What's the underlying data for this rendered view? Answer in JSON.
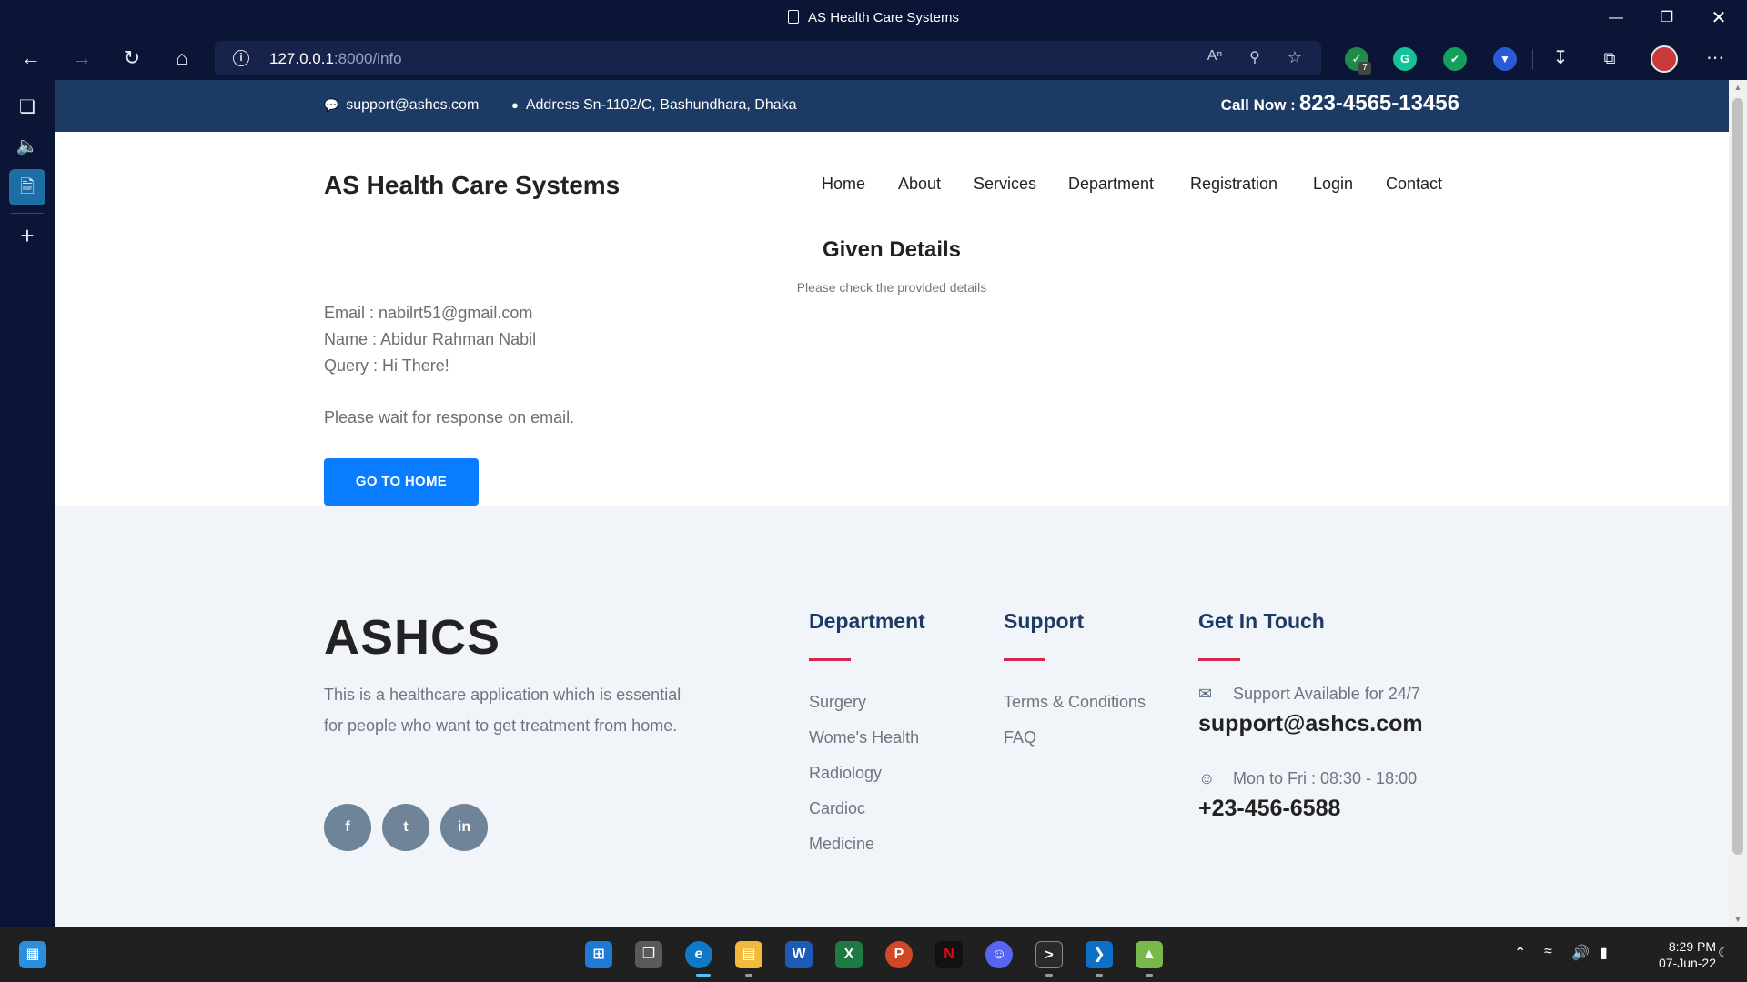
{
  "browser": {
    "window_title": "AS Health Care Systems",
    "url_host": "127.0.0.1",
    "url_path": ":8000/info",
    "extension_badge": "7",
    "ext_g": "G"
  },
  "site": {
    "top_email": "support@ashcs.com",
    "top_address": "Address Sn-1102/C, Bashundhara, Dhaka",
    "call_label": "Call Now :",
    "call_number": "823-4565-13456",
    "brand": "AS Health Care Systems",
    "nav": [
      "Home",
      "About",
      "Services",
      "Department",
      "Registration",
      "Login",
      "Contact"
    ]
  },
  "details": {
    "title": "Given Details",
    "subtitle": "Please check the provided details",
    "email": "Email : nabilrt51@gmail.com",
    "name": "Name : Abidur Rahman Nabil",
    "query": "Query : Hi There!",
    "note": "Please wait for response on email.",
    "button": "GO TO HOME"
  },
  "footer": {
    "brand": "ASHCS",
    "description": "This is a healthcare application which is essential for people who want to get treatment from home.",
    "social": [
      "f",
      "t",
      "in"
    ],
    "department_title": "Department",
    "department_links": [
      "Surgery",
      "Wome's Health",
      "Radiology",
      "Cardioc",
      "Medicine"
    ],
    "support_title": "Support",
    "support_links": [
      "Terms & Conditions",
      "FAQ"
    ],
    "contact_title": "Get In Touch",
    "support_available": "Support Available for 24/7",
    "support_email": "support@ashcs.com",
    "hours": "Mon to Fri : 08:30 - 18:00",
    "phone": "+23-456-6588"
  },
  "taskbar": {
    "time": "8:29 PM",
    "date": "07-Jun-22"
  },
  "colors": {
    "browser_bg": "#0b1536",
    "topstrip": "#1c3a63",
    "button": "#0a7cff",
    "accent_line": "#d4284b",
    "footer_bg": "#f1f5f9"
  }
}
